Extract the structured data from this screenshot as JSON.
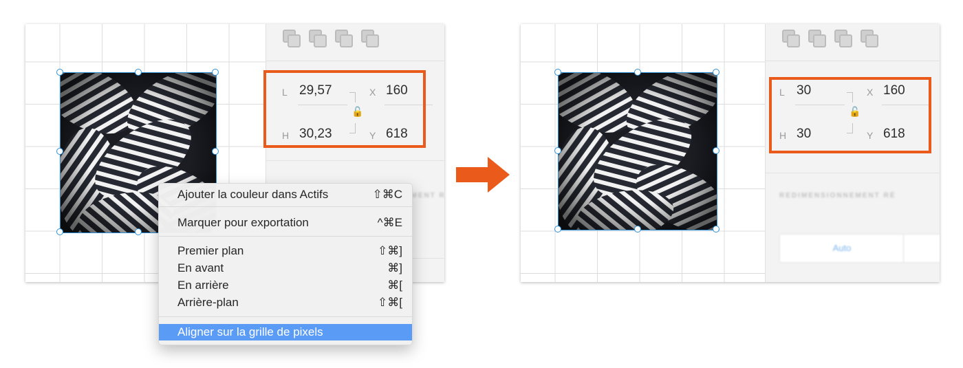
{
  "colors": {
    "accent_orange": "#ea5a1b",
    "selection_blue": "#2c8fd8",
    "menu_highlight": "#5a9bf5"
  },
  "arrow_icon": "right-arrow-icon",
  "before": {
    "fields": {
      "width_label": "L",
      "width_value": "29,57",
      "height_label": "H",
      "height_value": "30,23",
      "x_label": "X",
      "x_value": "160",
      "y_label": "Y",
      "y_value": "618"
    },
    "section_title": "REDIMENSIONNEMENT RÉ"
  },
  "after": {
    "fields": {
      "width_label": "L",
      "width_value": "30",
      "height_label": "H",
      "height_value": "30",
      "x_label": "X",
      "x_value": "160",
      "y_label": "Y",
      "y_value": "618"
    },
    "section_title": "REDIMENSIONNEMENT RÉ",
    "mode_button": "Auto"
  },
  "context_menu": {
    "groups": [
      [
        {
          "label": "Ajouter la couleur dans Actifs",
          "shortcut": "⇧⌘C"
        }
      ],
      [
        {
          "label": "Marquer pour exportation",
          "shortcut": "^⌘E"
        }
      ],
      [
        {
          "label": "Premier plan",
          "shortcut": "⇧⌘]"
        },
        {
          "label": "En avant",
          "shortcut": "⌘]"
        },
        {
          "label": "En arrière",
          "shortcut": "⌘["
        },
        {
          "label": "Arrière-plan",
          "shortcut": "⇧⌘["
        }
      ],
      [
        {
          "label": "Aligner sur la grille de pixels",
          "shortcut": "",
          "highlighted": true
        }
      ]
    ]
  }
}
